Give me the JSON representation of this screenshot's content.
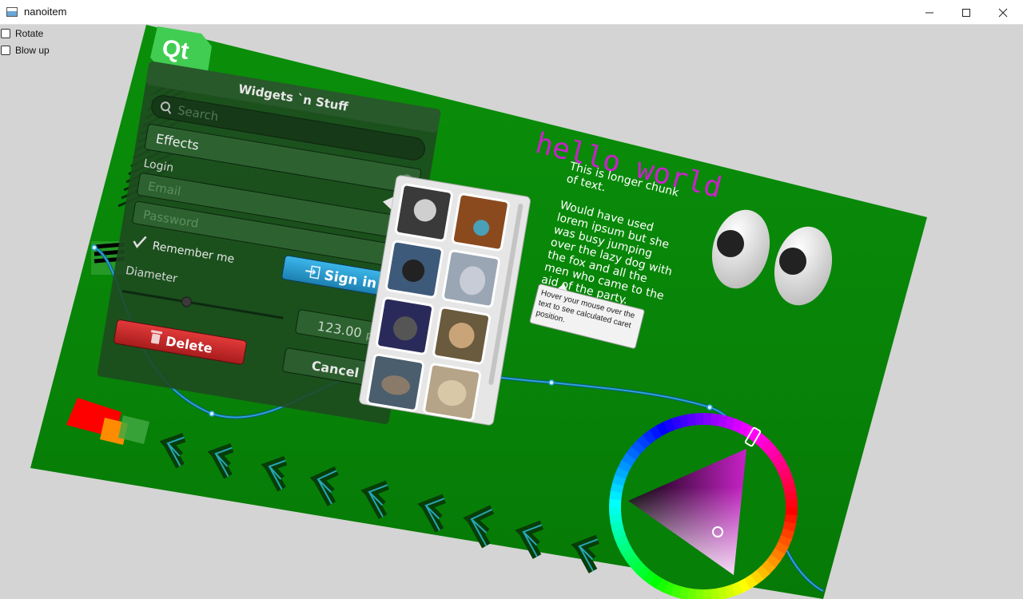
{
  "window": {
    "title": "nanoitem",
    "minimize_icon": "minimize-icon",
    "maximize_icon": "maximize-icon",
    "close_icon": "close-icon"
  },
  "controls": {
    "rotate_label": "Rotate",
    "rotate_checked": false,
    "blowup_label": "Blow up",
    "blowup_checked": false
  },
  "logo": {
    "text": "Qt"
  },
  "panel": {
    "title": "Widgets `n Stuff",
    "search_placeholder": "Search",
    "dropdown_value": "Effects",
    "login_label": "Login",
    "email_placeholder": "Email",
    "password_placeholder": "Password",
    "remember_label": "Remember me",
    "remember_checked": true,
    "signin_label": "Sign in",
    "diameter_label": "Diameter",
    "slider_fraction": 0.4,
    "number_value": "123.00",
    "number_unit": "px",
    "delete_label": "Delete",
    "cancel_label": "Cancel"
  },
  "hello": {
    "text": "hello world",
    "color": "#c822c8"
  },
  "paragraph": {
    "lines": [
      "This is longer chunk",
      "of text.",
      "",
      "Would have used",
      "lorem ipsum but she",
      "was busy jumping",
      "over the lazy dog with",
      "the fox and all the",
      "men who came to the",
      "aid of the party."
    ]
  },
  "tooltip": {
    "lines": [
      "Hover your mouse over the",
      "text to see calculated caret",
      "position."
    ]
  },
  "colors": {
    "background": "#078a07",
    "accent_blue": "#29a3d6",
    "delete_red": "#c42a2a"
  },
  "color_picker": {
    "hue_degrees": 300,
    "selected_color": "#c822c8"
  }
}
